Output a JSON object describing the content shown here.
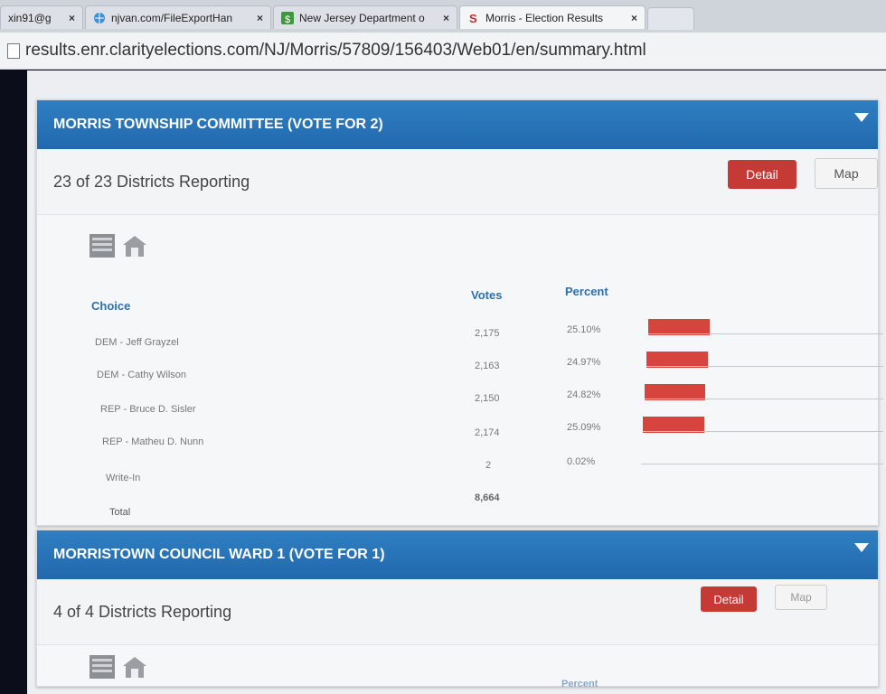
{
  "browser": {
    "tabs": [
      {
        "label": "xin91@g",
        "close": "×"
      },
      {
        "label": "njvan.com/FileExportHan",
        "close": "×"
      },
      {
        "label": "New Jersey Department o",
        "close": "×"
      },
      {
        "label": "Morris - Election Results",
        "close": "×"
      }
    ],
    "url": "results.enr.clarityelections.com/NJ/Morris/57809/156403/Web01/en/summary.html"
  },
  "contest1": {
    "title": "MORRIS TOWNSHIP COMMITTEE (VOTE FOR 2)",
    "reporting": "23 of 23 Districts Reporting",
    "detail_label": "Detail",
    "map_label": "Map",
    "columns": {
      "choice": "Choice",
      "votes": "Votes",
      "percent": "Percent"
    },
    "rows": [
      {
        "choice": "DEM - Jeff Grayzel",
        "votes": "2,175",
        "percent": "25.10%",
        "pct_value": 25.1
      },
      {
        "choice": "DEM - Cathy Wilson",
        "votes": "2,163",
        "percent": "24.97%",
        "pct_value": 24.97
      },
      {
        "choice": "REP - Bruce D. Sisler",
        "votes": "2,150",
        "percent": "24.82%",
        "pct_value": 24.82
      },
      {
        "choice": "REP - Matheu D. Nunn",
        "votes": "2,174",
        "percent": "25.09%",
        "pct_value": 25.09
      },
      {
        "choice": "Write-In",
        "votes": "2",
        "percent": "0.02%",
        "pct_value": 0.02
      }
    ],
    "total_label": "Total",
    "total_votes": "8,664"
  },
  "contest2": {
    "title": "MORRISTOWN COUNCIL WARD 1 (VOTE FOR 1)",
    "reporting": "4 of 4 Districts Reporting",
    "detail_label": "Detail",
    "map_label": "Map",
    "percent_label": "Percent"
  },
  "colors": {
    "header_blue": "#2268ad",
    "bar_red": "#d6443d",
    "detail_red": "#c53a34",
    "link_blue": "#2f6fab"
  }
}
